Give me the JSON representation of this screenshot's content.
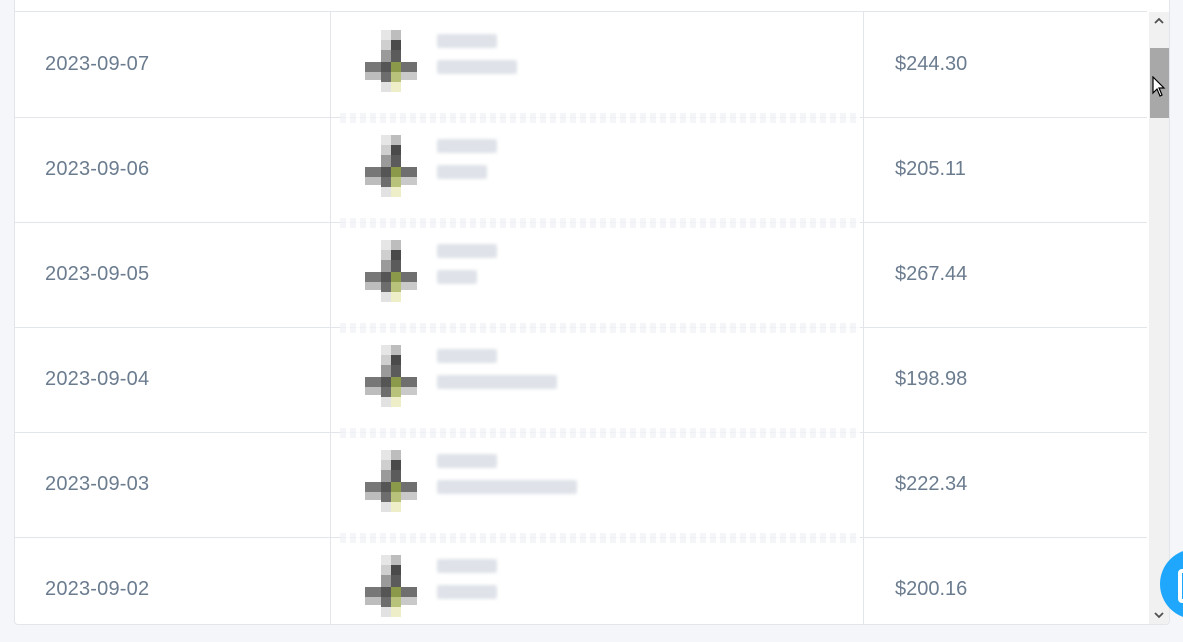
{
  "table": {
    "rows": [
      {
        "date": "2023-09-07",
        "amount": "$244.30"
      },
      {
        "date": "2023-09-06",
        "amount": "$205.11"
      },
      {
        "date": "2023-09-05",
        "amount": "$267.44"
      },
      {
        "date": "2023-09-04",
        "amount": "$198.98"
      },
      {
        "date": "2023-09-03",
        "amount": "$222.34"
      },
      {
        "date": "2023-09-02",
        "amount": "$200.16"
      }
    ]
  },
  "scrollbar": {
    "up_icon": "chevron-up-icon",
    "down_icon": "chevron-down-icon"
  },
  "colors": {
    "text": "#6b7c8f",
    "border": "#e2e5ea",
    "chat_accent": "#1ea7fd"
  },
  "chat_widget": {
    "icon": "chat-icon"
  }
}
